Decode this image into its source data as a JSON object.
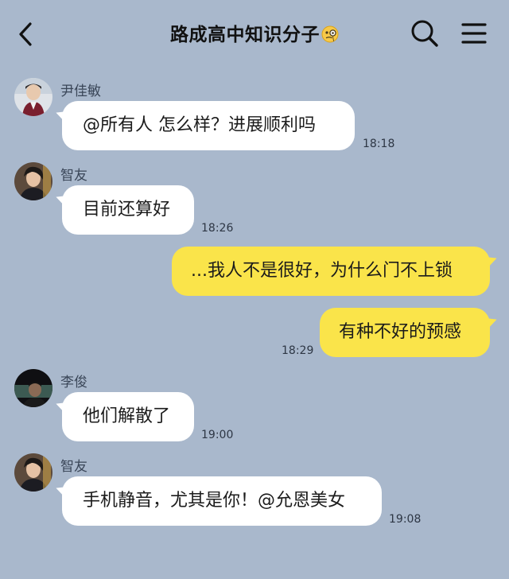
{
  "header": {
    "title": "路成高中知识分子",
    "emoji_icon": "monocle-face-icon"
  },
  "colors": {
    "background": "#a9b8cc",
    "incoming_bubble": "#ffffff",
    "outgoing_bubble": "#fae44a"
  },
  "messages": [
    {
      "sender": "尹佳敏",
      "text": "@所有人  怎么样？进展顺利吗",
      "time": "18:18",
      "direction": "in"
    },
    {
      "sender": "智友",
      "text": "目前还算好",
      "time": "18:26",
      "direction": "in"
    },
    {
      "sender": "",
      "text": "...我人不是很好，为什么门不上锁",
      "time": "",
      "direction": "out"
    },
    {
      "sender": "",
      "text": "有种不好的预感",
      "time": "18:29",
      "direction": "out"
    },
    {
      "sender": "李俊",
      "text": "他们解散了",
      "time": "19:00",
      "direction": "in"
    },
    {
      "sender": "智友",
      "text": "手机静音，尤其是你！@允恩美女",
      "time": "19:08",
      "direction": "in"
    }
  ]
}
